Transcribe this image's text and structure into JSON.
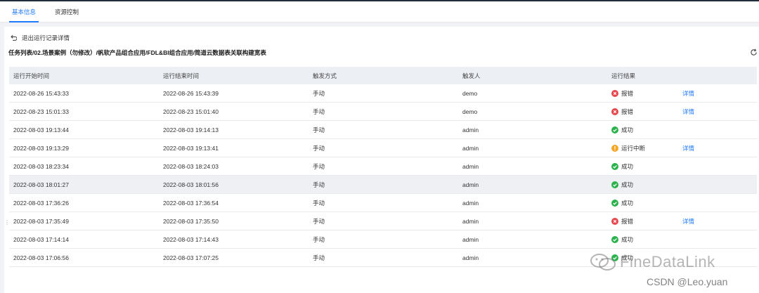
{
  "tabs": [
    {
      "label": "基本信息",
      "active": true
    },
    {
      "label": "资源控制",
      "active": false
    }
  ],
  "back_label": "退出运行记录详情",
  "breadcrumb": "任务列表/02.场景案例（勿修改）/帆软产品组合应用/FDL&BI组合应用/简道云数据表关联构建宽表",
  "columns": [
    "运行开始时间",
    "运行结束时间",
    "触发方式",
    "触发人",
    "运行结果",
    ""
  ],
  "rows": [
    {
      "start": "2022-08-26 15:43:33",
      "end": "2022-08-26 15:43:39",
      "trigger": "手动",
      "user": "demo",
      "status": "error",
      "result": "报错",
      "detail": "详情"
    },
    {
      "start": "2022-08-23 15:01:33",
      "end": "2022-08-23 15:01:40",
      "trigger": "手动",
      "user": "demo",
      "status": "error",
      "result": "报错",
      "detail": "详情"
    },
    {
      "start": "2022-08-03 19:13:44",
      "end": "2022-08-03 19:14:13",
      "trigger": "手动",
      "user": "admin",
      "status": "success",
      "result": "成功",
      "detail": ""
    },
    {
      "start": "2022-08-03 19:13:29",
      "end": "2022-08-03 19:13:41",
      "trigger": "手动",
      "user": "admin",
      "status": "warning",
      "result": "运行中断",
      "detail": "详情"
    },
    {
      "start": "2022-08-03 18:23:34",
      "end": "2022-08-03 18:24:03",
      "trigger": "手动",
      "user": "admin",
      "status": "success",
      "result": "成功",
      "detail": ""
    },
    {
      "start": "2022-08-03 18:01:27",
      "end": "2022-08-03 18:01:56",
      "trigger": "手动",
      "user": "admin",
      "status": "success",
      "result": "成功",
      "detail": "",
      "highlight": true
    },
    {
      "start": "2022-08-03 17:36:26",
      "end": "2022-08-03 17:36:54",
      "trigger": "手动",
      "user": "admin",
      "status": "success",
      "result": "成功",
      "detail": ""
    },
    {
      "start": "2022-08-03 17:35:49",
      "end": "2022-08-03 17:35:50",
      "trigger": "手动",
      "user": "admin",
      "status": "error",
      "result": "报错",
      "detail": "详情"
    },
    {
      "start": "2022-08-03 17:14:14",
      "end": "2022-08-03 17:14:43",
      "trigger": "手动",
      "user": "admin",
      "status": "success",
      "result": "成功",
      "detail": ""
    },
    {
      "start": "2022-08-03 17:06:56",
      "end": "2022-08-03 17:07:25",
      "trigger": "手动",
      "user": "admin",
      "status": "success",
      "result": "成功",
      "detail": ""
    }
  ],
  "colors": {
    "accent": "#1f7aff",
    "error": "#e5484d",
    "success": "#2bb24c",
    "warning": "#f5a623"
  },
  "icons": {
    "back": "back-arrow-icon",
    "refresh": "refresh-icon",
    "error": "error-circle-icon",
    "success": "success-check-icon",
    "warning": "warning-circle-icon"
  },
  "watermark": {
    "brand": "FineDataLink",
    "credit": "CSDN @Leo.yuan"
  }
}
